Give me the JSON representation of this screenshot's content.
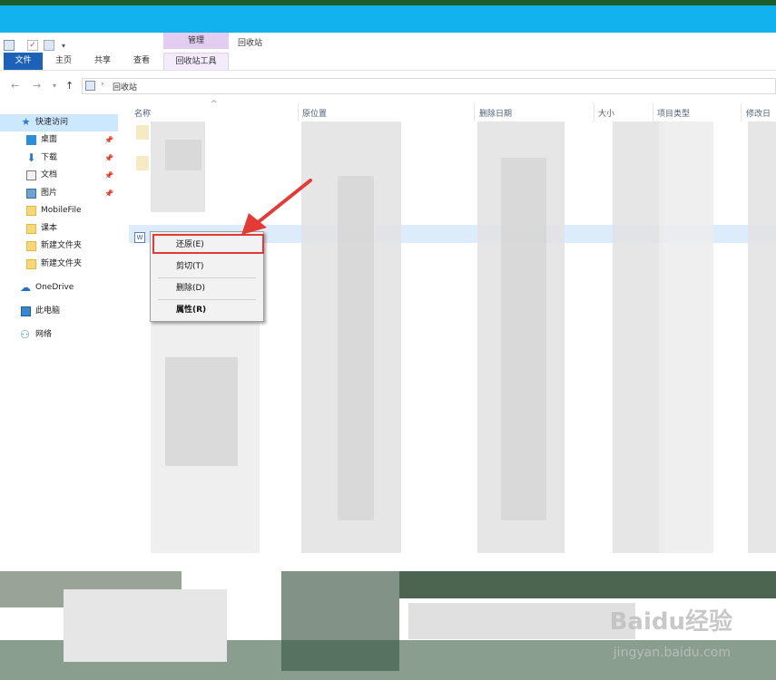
{
  "window": {
    "title": "回收站",
    "contextual_group": "管理",
    "accent_color": "#12b2ef"
  },
  "ribbon": {
    "tabs": [
      "文件",
      "主页",
      "共享",
      "查看",
      "回收站工具"
    ]
  },
  "address": {
    "path": "回收站",
    "back_icon": "arrow-left-icon",
    "forward_icon": "arrow-right-icon",
    "up_icon": "arrow-up-icon"
  },
  "nav": {
    "items": [
      {
        "label": "快速访问",
        "icon": "star-icon",
        "pinned": false,
        "selected": true
      },
      {
        "label": "桌面",
        "icon": "desktop-icon",
        "pinned": true
      },
      {
        "label": "下载",
        "icon": "download-icon",
        "pinned": true
      },
      {
        "label": "文档",
        "icon": "document-icon",
        "pinned": true
      },
      {
        "label": "图片",
        "icon": "picture-icon",
        "pinned": true
      },
      {
        "label": "MobileFile",
        "icon": "folder-icon"
      },
      {
        "label": "课本",
        "icon": "folder-icon"
      },
      {
        "label": "新建文件夹",
        "icon": "folder-icon"
      },
      {
        "label": "新建文件夹",
        "icon": "folder-icon"
      },
      {
        "label": "OneDrive",
        "icon": "cloud-icon"
      },
      {
        "label": "此电脑",
        "icon": "computer-icon"
      },
      {
        "label": "网络",
        "icon": "network-icon"
      }
    ]
  },
  "columns": [
    "名称",
    "原位置",
    "删除日期",
    "大小",
    "项目类型",
    "修改日"
  ],
  "context_menu": {
    "items": [
      {
        "label": "还原(E)",
        "highlighted": true
      },
      {
        "label": "剪切(T)"
      },
      {
        "label": "删除(D)"
      },
      {
        "label": "属性(R)",
        "bold": true
      }
    ]
  },
  "watermark": {
    "brand": "Baidu经验",
    "url": "jingyan.baidu.com"
  }
}
